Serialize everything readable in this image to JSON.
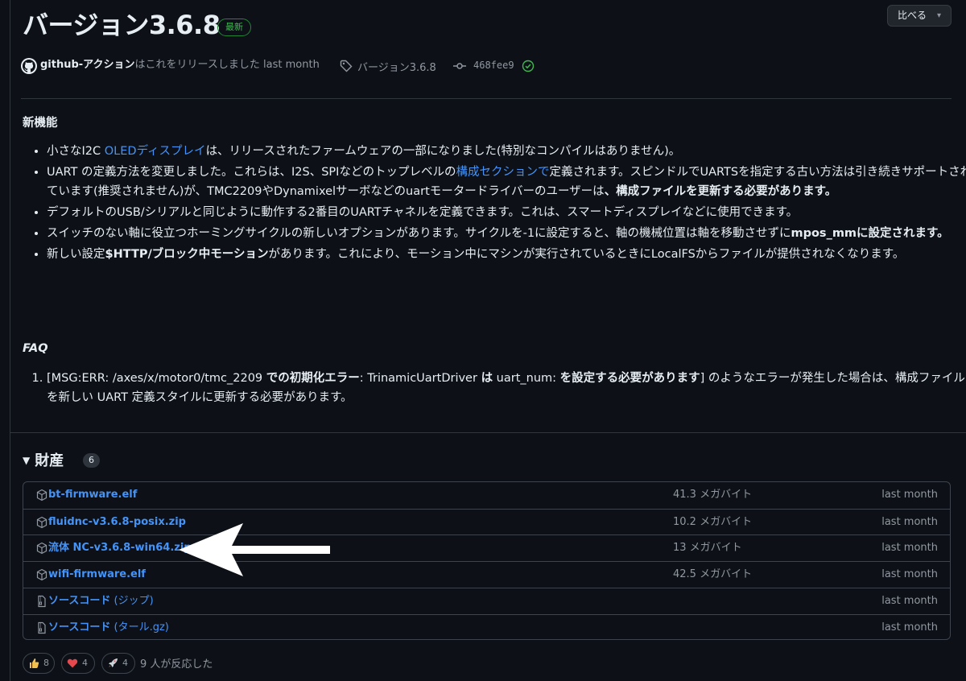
{
  "release": {
    "title": "バージョン3.6.8",
    "latest_badge": "最新",
    "compare_label": "比べる",
    "author": "github-アクション",
    "released_text": "はこれをリリースしました last month",
    "tag": "バージョン3.6.8",
    "commit": "468fee9"
  },
  "notes": {
    "new_features_heading": "新機能",
    "items": [
      {
        "parts": [
          "小さなI2C ",
          "OLEDディスプレイ",
          "は、リリースされたファームウェアの一部になりました(特別なコンパイルはありません)。"
        ]
      },
      {
        "parts": [
          "UART の定義方法を変更しました。これらは、I2S、SPIなどのトップレベルの",
          "構成セクションで",
          "定義されます。スピンドルでUARTSを指定する古い方法は引き続きサポートされています(推奨されません)が、TMC2209やDynamixelサーボなどのuartモータードライバーのユーザーは",
          "、構成ファイルを更新する必要があります。"
        ]
      },
      {
        "text": "デフォルトのUSB/シリアルと同じように動作する2番目のUARTチャネルを定義できます。これは、スマートディスプレイなどに使用できます。"
      },
      {
        "parts": [
          "スイッチのない軸に役立つホーミングサイクルの新しいオプションがあります。サイクルを-1に設定すると、軸の機械位置は軸を移動させずに",
          "mpos_mmに設定されます。"
        ]
      },
      {
        "parts": [
          "新しい設定",
          "$HTTP/ブロック中モーション",
          "があります。これにより、モーション中にマシンが実行されているときにLocalFSからファイルが提供されなくなります。"
        ]
      }
    ],
    "faq_heading": "FAQ",
    "faq_items": [
      {
        "parts": [
          "[MSG:ERR: /axes/x/motor0/tmc_2209 ",
          "での初期化エラー",
          ": TrinamicUartDriver ",
          "は",
          " uart_num: ",
          "を設定する必要があります",
          "] のようなエラーが発生した場合は、構成ファイルを新しい UART 定義スタイルに更新する必要があります。"
        ]
      }
    ]
  },
  "assets": {
    "heading": "財産",
    "count": "6",
    "rows": [
      {
        "name": "bt-firmware.elf",
        "size": "41.3 メガバイト",
        "date": "last month",
        "icon": "package-icon"
      },
      {
        "name": "fluidnc-v3.6.8-posix.zip",
        "size": "10.2 メガバイト",
        "date": "last month",
        "icon": "package-icon"
      },
      {
        "name": "流体 NC-v3.6.8-win64.zip",
        "size": "13 メガバイト",
        "date": "last month",
        "icon": "package-icon"
      },
      {
        "name": "wifi-firmware.elf",
        "size": "42.5 メガバイト",
        "date": "last month",
        "icon": "package-icon"
      },
      {
        "name": "ソースコード",
        "suffix": " (ジップ)",
        "size": "",
        "date": "last month",
        "icon": "file-zip-icon"
      },
      {
        "name": "ソースコード",
        "suffix": " (タール.gz)",
        "size": "",
        "date": "last month",
        "icon": "file-zip-icon"
      }
    ]
  },
  "reactions": {
    "thumbs_up": "8",
    "heart": "4",
    "rocket": "4",
    "summary": "9 人が反応した"
  }
}
